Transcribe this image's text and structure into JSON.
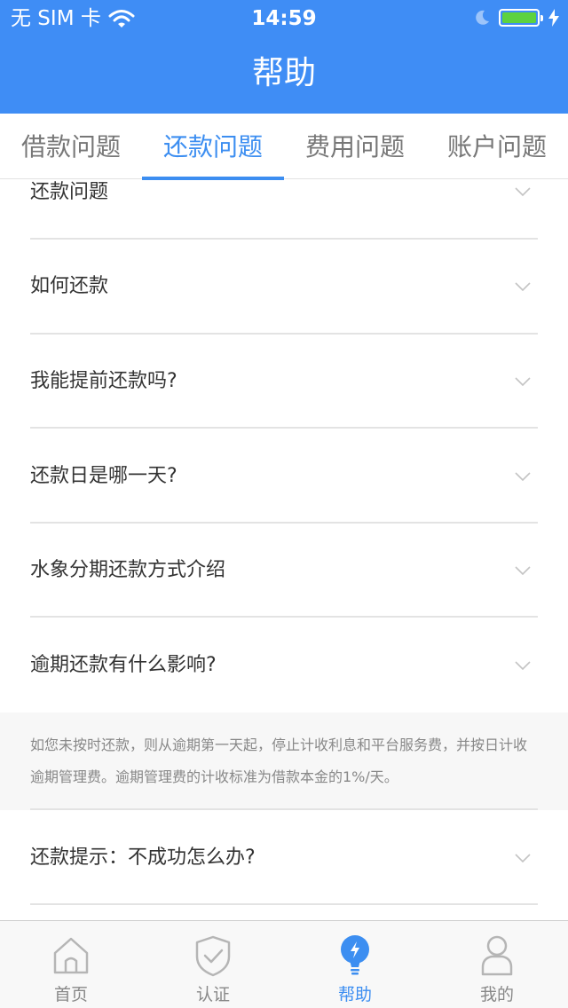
{
  "status_bar": {
    "carrier": "无 SIM 卡",
    "time": "14:59",
    "battery_level": 1.0,
    "icons": [
      "wifi-icon",
      "moon-icon",
      "battery-icon",
      "charging-icon"
    ]
  },
  "header": {
    "title": "帮助"
  },
  "tabs": [
    {
      "label": "借款问题",
      "active": false
    },
    {
      "label": "还款问题",
      "active": true
    },
    {
      "label": "费用问题",
      "active": false
    },
    {
      "label": "账户问题",
      "active": false
    }
  ],
  "faq": {
    "items": [
      {
        "question": "还款问题"
      },
      {
        "question": "如何还款"
      },
      {
        "question": "我能提前还款吗?"
      },
      {
        "question": "还款日是哪一天?"
      },
      {
        "question": "水象分期还款方式介绍"
      },
      {
        "question": "逾期还款有什么影响?"
      },
      {
        "question": "还款提示：不成功怎么办?"
      }
    ],
    "expanded_answer": "如您未按时还款，则从逾期第一天起，停止计收利息和平台服务费，并按日计收逾期管理费。逾期管理费的计收标准为借款本金的1%/天。"
  },
  "tabbar": [
    {
      "label": "首页",
      "icon": "home-icon",
      "active": false
    },
    {
      "label": "认证",
      "icon": "shield-check-icon",
      "active": false
    },
    {
      "label": "帮助",
      "icon": "lightbulb-icon",
      "active": true
    },
    {
      "label": "我的",
      "icon": "user-icon",
      "active": false
    }
  ],
  "colors": {
    "header_bg": "#3f8df5",
    "accent": "#3c8ef1",
    "battery_green": "#5dd23f"
  }
}
